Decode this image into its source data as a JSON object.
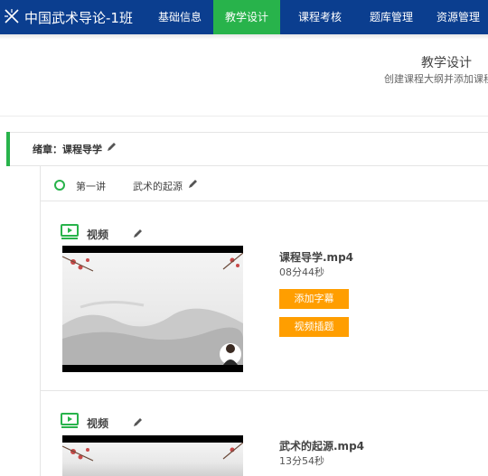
{
  "app": {
    "title": "中国武术导论-1班"
  },
  "nav": [
    {
      "label": "基础信息",
      "active": false
    },
    {
      "label": "教学设计",
      "active": true
    },
    {
      "label": "课程考核",
      "active": false
    },
    {
      "label": "题库管理",
      "active": false
    },
    {
      "label": "资源管理",
      "active": false
    }
  ],
  "page": {
    "title": "教学设计",
    "subtitle": "创建课程大纲并添加课程"
  },
  "chapter": {
    "title": "绪章：课程导学"
  },
  "lecture": {
    "number": "第一讲",
    "name": "武术的起源"
  },
  "videos": [
    {
      "type_label": "视频",
      "file_name": "课程导学.mp4",
      "duration": "08分44秒",
      "buttons": {
        "subtitle": "添加字幕",
        "quiz": "视频插题"
      }
    },
    {
      "type_label": "视频",
      "file_name": "武术的起源.mp4",
      "duration": "13分54秒"
    }
  ],
  "colors": {
    "nav_bg": "#0b3e8f",
    "accent_green": "#28b34b",
    "button_orange": "#ff9e00"
  }
}
